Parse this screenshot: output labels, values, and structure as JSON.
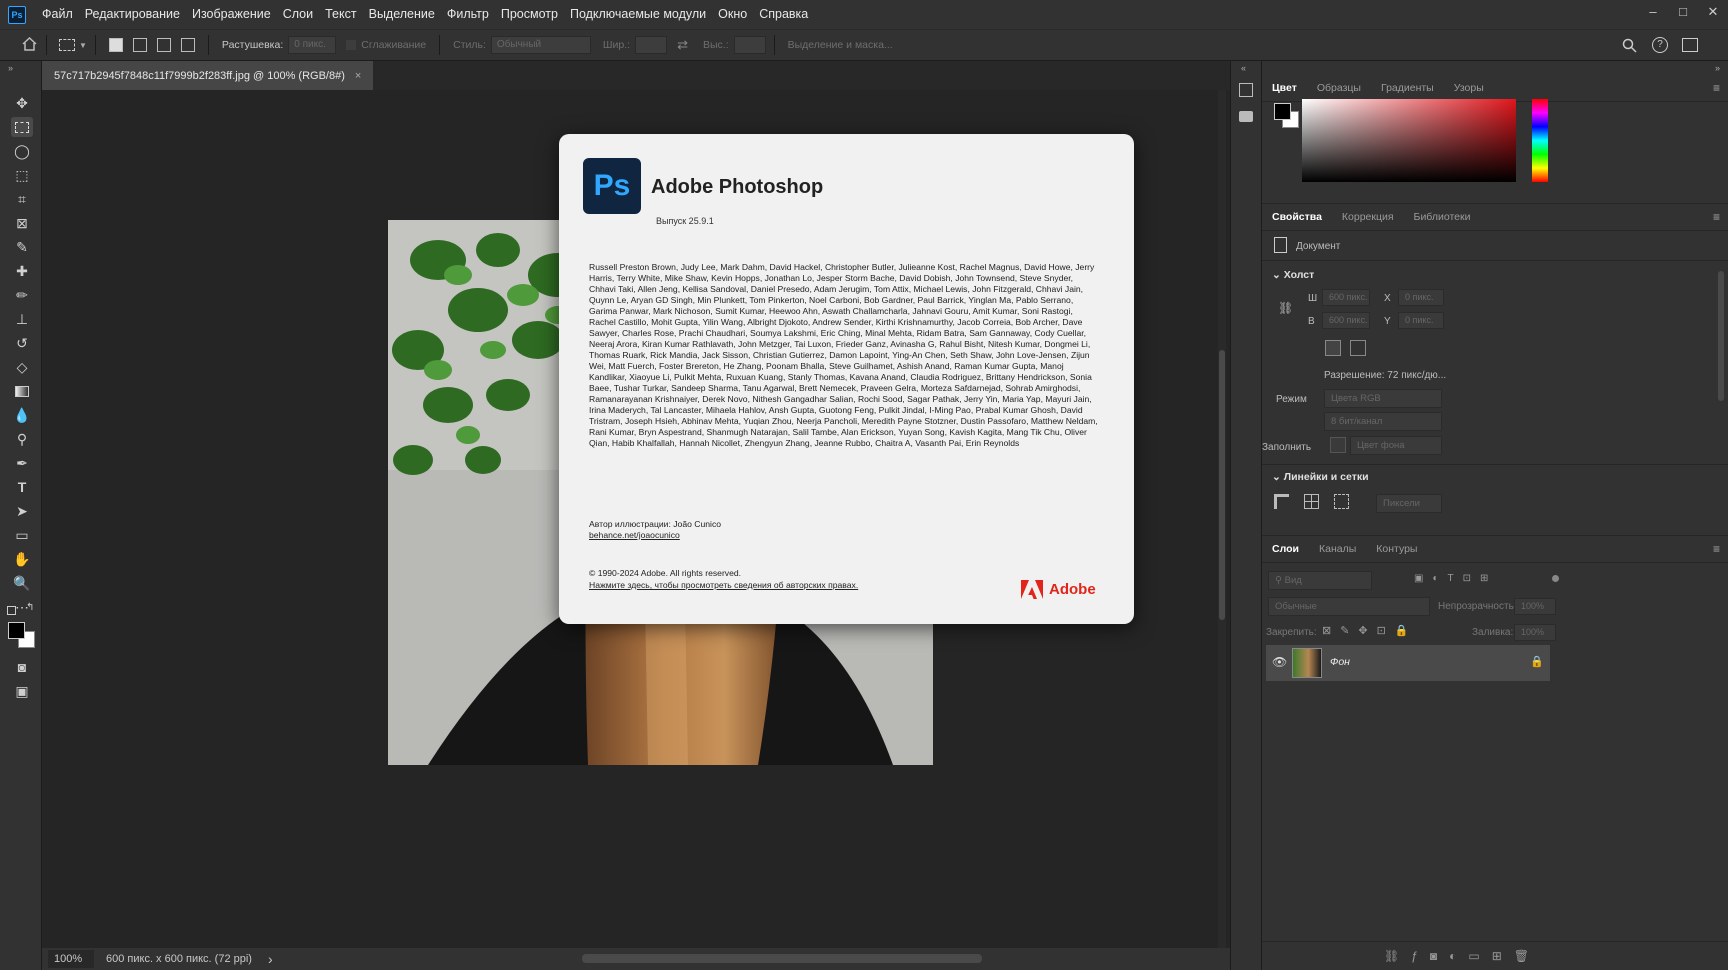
{
  "menubar": {
    "logo": "Ps",
    "items": [
      "Файл",
      "Редактирование",
      "Изображение",
      "Слои",
      "Текст",
      "Выделение",
      "Фильтр",
      "Просмотр",
      "Подключаемые модули",
      "Окно",
      "Справка"
    ]
  },
  "window_controls": {
    "minimize": "–",
    "maximize": "□",
    "close": "✕"
  },
  "options_bar": {
    "feather_label": "Растушевка:",
    "feather_value": "0 пикс.",
    "antialias_label": "Сглаживание",
    "style_label": "Стиль:",
    "style_value": "Обычный",
    "width_label": "Шир.:",
    "height_label": "Выс.:",
    "select_mask_label": "Выделение и маска..."
  },
  "document": {
    "tab_title": "57c717b2945f7848c11f7999b2f283ff.jpg @ 100% (RGB/8#)",
    "tab_close": "×"
  },
  "status": {
    "zoom": "100%",
    "doc_info": "600 пикс. x 600 пикс. (72 ppi)",
    "arrow": "›"
  },
  "about": {
    "logo": "Ps",
    "title": "Adobe Photoshop",
    "version": "Выпуск 25.9.1",
    "credits": "Russell Preston Brown, Judy Lee, Mark Dahm, David Hackel, Christopher Butler, Julieanne Kost, Rachel Magnus, David Howe, Jerry Harris, Terry White, Mike Shaw, Kevin Hopps, Jonathan Lo, Jesper Storm Bache, David Dobish, John Townsend, Steve Snyder, Chhavi Taki, Allen Jeng, Kellisa Sandoval, Daniel Presedo, Adam Jerugim, Tom Attix, Michael Lewis, John Fitzgerald, Chhavi Jain, Quynn Le, Aryan GD Singh, Min Plunkett, Tom Pinkerton, Noel Carboni, Bob Gardner, Paul Barrick, Yinglan Ma, Pablo Serrano, Garima Panwar, Mark Nichoson, Sumit Kumar, Heewoo Ahn, Aswath Challamcharla, Jahnavi Gouru, Amit Kumar, Soni Rastogi, Rachel Castillo, Mohit Gupta, Yilin Wang, Albright Djokoto, Andrew Sender, Kirthi Krishnamurthy, Jacob Correia, Bob Archer, Dave Sawyer, Charles Rose, Prachi Chaudhari, Soumya Lakshmi, Eric Ching, Minal Mehta, Ridam Batra, Sam Gannaway, Cody Cuellar, Neeraj Arora, Kiran Kumar Rathlavath, John Metzger, Tai Luxon, Frieder Ganz, Avinasha G, Rahul Bisht, Nitesh Kumar, Dongmei Li, Thomas Ruark, Rick Mandia, Jack Sisson, Christian Gutierrez, Damon Lapoint, Ying-An Chen, Seth Shaw, John Love-Jensen, Zijun Wei, Matt Fuerch, Foster Brereton, He Zhang, Poonam Bhalla, Steve Guilhamet, Ashish Anand, Raman Kumar Gupta, Manoj Kandlikar, Xiaoyue Li, Pulkit Mehta, Ruxuan Kuang, Stanly Thomas, Kavana Anand, Claudia Rodriguez, Brittany Hendrickson, Sonia Baee, Tushar Turkar, Sandeep Sharma, Tanu Agarwal, Brett Nemecek, Praveen Gelra, Morteza Safdarnejad, Sohrab Amirghodsi, Ramanarayanan Krishnaiyer, Derek Novo, Nithesh Gangadhar Salian, Rochi Sood, Sagar Pathak, Jerry Yin, Maria Yap, Mayuri Jain, Irina Maderych, Tal Lancaster, Mihaela Hahlov, Ansh Gupta, Guotong Feng, Pulkit Jindal, I-Ming Pao, Prabal Kumar Ghosh, David Tristram, Joseph Hsieh, Abhinav Mehta, Yuqian Zhou, Neerja Pancholi, Meredith Payne Stotzner, Dustin Passofaro, Matthew Neldam, Rani Kumar, Bryn Aspestrand, Shanmugh Natarajan, Salil Tambe, Alan Erickson, Yuyan Song, Kavish Kagita, Mang Tik Chu, Oliver Qian, Habib Khalfallah, Hannah Nicollet, Zhengyun Zhang, Jeanne Rubbo, Chaitra A, Vasanth Pai, Erin Reynolds",
    "illus_label": "Автор иллюстрации: João Cunico",
    "illus_link": "behance.net/joaocunico",
    "copyright": "© 1990-2024 Adobe. All rights reserved.",
    "legal_link": "Нажмите здесь, чтобы просмотреть сведения об авторских правах.",
    "brand": "Adobe"
  },
  "color_panel": {
    "tabs": [
      "Цвет",
      "Образцы",
      "Градиенты",
      "Узоры"
    ]
  },
  "properties_panel": {
    "tabs": [
      "Свойства",
      "Коррекция",
      "Библиотеки"
    ],
    "doc_label": "Документ",
    "canvas_header": "Холст",
    "w_label": "Ш",
    "w_value": "600 пикс.",
    "x_label": "X",
    "x_value": "0 пикс.",
    "h_label": "В",
    "h_value": "600 пикс.",
    "y_label": "Y",
    "y_value": "0 пикс.",
    "resolution": "Разрешение: 72 пикс/дю...",
    "mode_label": "Режим",
    "mode_value": "Цвета RGB",
    "depth_value": "8 бит/канал",
    "fill_label": "Заполнить",
    "fill_value": "Цвет фона",
    "rulers_header": "Линейки и сетки",
    "units_value": "Пиксели"
  },
  "layers_panel": {
    "tabs": [
      "Слои",
      "Каналы",
      "Контуры"
    ],
    "search_placeholder": "Вид",
    "blend_mode": "Обычные",
    "opacity_label": "Непрозрачность:",
    "opacity_value": "100%",
    "lock_label": "Закрепить:",
    "fill_label": "Заливка:",
    "fill_value": "100%",
    "layer_name": "Фон"
  }
}
